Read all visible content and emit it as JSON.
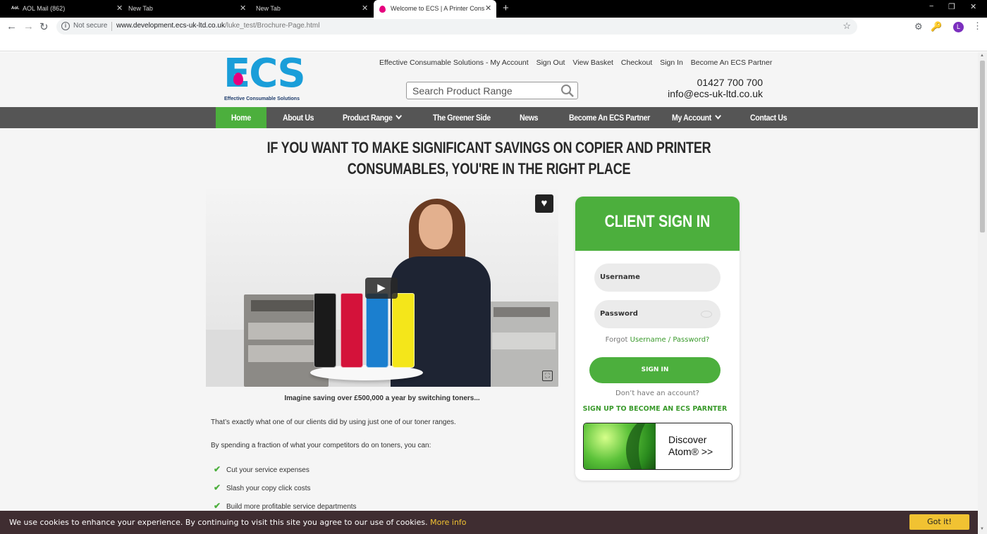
{
  "browser": {
    "tabs": [
      {
        "favicon": "Aol.",
        "title": "AOL Mail (862)",
        "close": "✕"
      },
      {
        "favicon": "",
        "title": "New Tab",
        "close": "✕"
      },
      {
        "favicon": "",
        "title": "New Tab",
        "close": "✕"
      },
      {
        "favicon": "",
        "title": "Welcome to ECS | A Printer Cons",
        "close": "✕"
      }
    ],
    "new_tab": "+",
    "window_controls": {
      "minimize": "−",
      "restore": "❐",
      "close": "✕"
    },
    "address": {
      "security_label": "Not secure",
      "url_host": "www.development.ecs-uk-ltd.co.uk",
      "url_path": "/luke_test/Brochure-Page.html"
    },
    "profile_initial": "L"
  },
  "site": {
    "logo": {
      "text": "ECS",
      "tagline": "Effective Consumable Solutions"
    },
    "top_links": [
      "Effective Consumable Solutions - My Account",
      "Sign Out",
      "View Basket",
      "Checkout",
      "Sign In",
      "Become An ECS Partner"
    ],
    "search": {
      "placeholder": "Search Product Range"
    },
    "contact": {
      "phone": "01427 700 700",
      "email": "info@ecs-uk-ltd.co.uk"
    },
    "nav": [
      {
        "label": "Home",
        "active": true
      },
      {
        "label": "About Us"
      },
      {
        "label": "Product Range",
        "dropdown": true
      },
      {
        "label": "The Greener Side"
      },
      {
        "label": "News"
      },
      {
        "label": "Become An ECS Partner"
      },
      {
        "label": "My Account",
        "dropdown": true
      },
      {
        "label": "Contact Us"
      }
    ],
    "headline": [
      "IF YOU WANT TO MAKE SIGNIFICANT SAVINGS ON COPIER AND PRINTER",
      "CONSUMABLES, YOU'RE IN THE RIGHT PLACE"
    ],
    "video": {
      "play": "▶",
      "favorite": "♥",
      "fullscreen": "⛶"
    },
    "caption": "Imagine saving over £500,000 a year by switching toners...",
    "paragraphs": [
      "That’s exactly what one of our clients did by using just one of our toner ranges.",
      "By spending a fraction of what your competitors do on toners, you can:"
    ],
    "bullets": [
      "Cut your service expenses",
      "Slash your copy click costs",
      "Build more profitable service departments"
    ],
    "signin": {
      "title": "CLIENT SIGN IN",
      "username_placeholder": "Username",
      "password_placeholder": "Password",
      "forgot_prefix": "Forgot ",
      "forgot_username": "Username",
      "forgot_sep": " / ",
      "forgot_password": "Password?",
      "button": "SIGN IN",
      "no_account": "Don’t have an account?",
      "signup": "SIGN UP TO BECOME AN ECS PARNTER",
      "atom_line1": "Discover",
      "atom_line2": "Atom® >>"
    },
    "cookie": {
      "text": "We use cookies to enhance your experience. By continuing to visit this site you agree to our use of cookies.",
      "more": "More info",
      "button": "Got it!"
    }
  }
}
